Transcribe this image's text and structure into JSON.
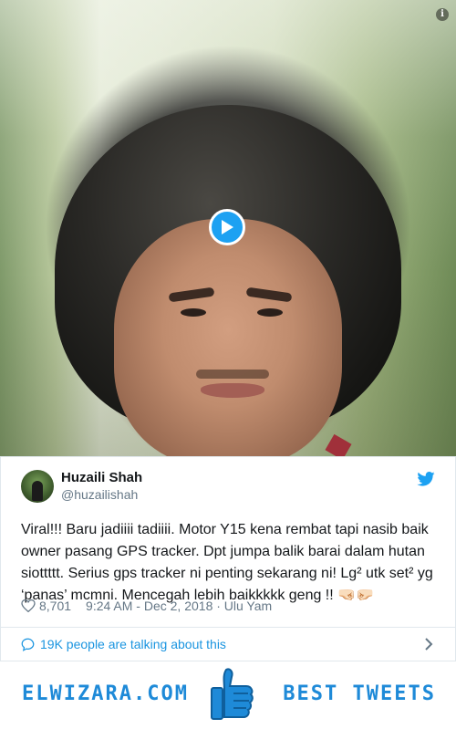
{
  "media": {
    "info_icon": "info-icon",
    "play_icon": "play-icon",
    "accent": "#1da1f2"
  },
  "tweet": {
    "author_name": "Huzaili Shah",
    "author_handle": "@huzailishah",
    "text": "Viral!!! Baru jadiiii tadiiii. Motor Y15 kena rembat tapi nasib baik owner pasang GPS tracker. Dpt jumpa balik barai dalam hutan siottttt. Serius gps tracker ni penting sekarang ni! Lg² utk set² yg ‘panas’ mcmni. Mencegah lebih baikkkkk geng !! 🤜🏻🤛🏻",
    "likes": "8,701",
    "timestamp": "9:24 AM - Dec 2, 2018 · Ulu Yam",
    "talking": "19K people are talking about this",
    "link_color": "#1b95e0"
  },
  "footer": {
    "brand": "ELWIZARA.COM",
    "best": "BEST TWEETS",
    "color": "#1e8ad8"
  }
}
